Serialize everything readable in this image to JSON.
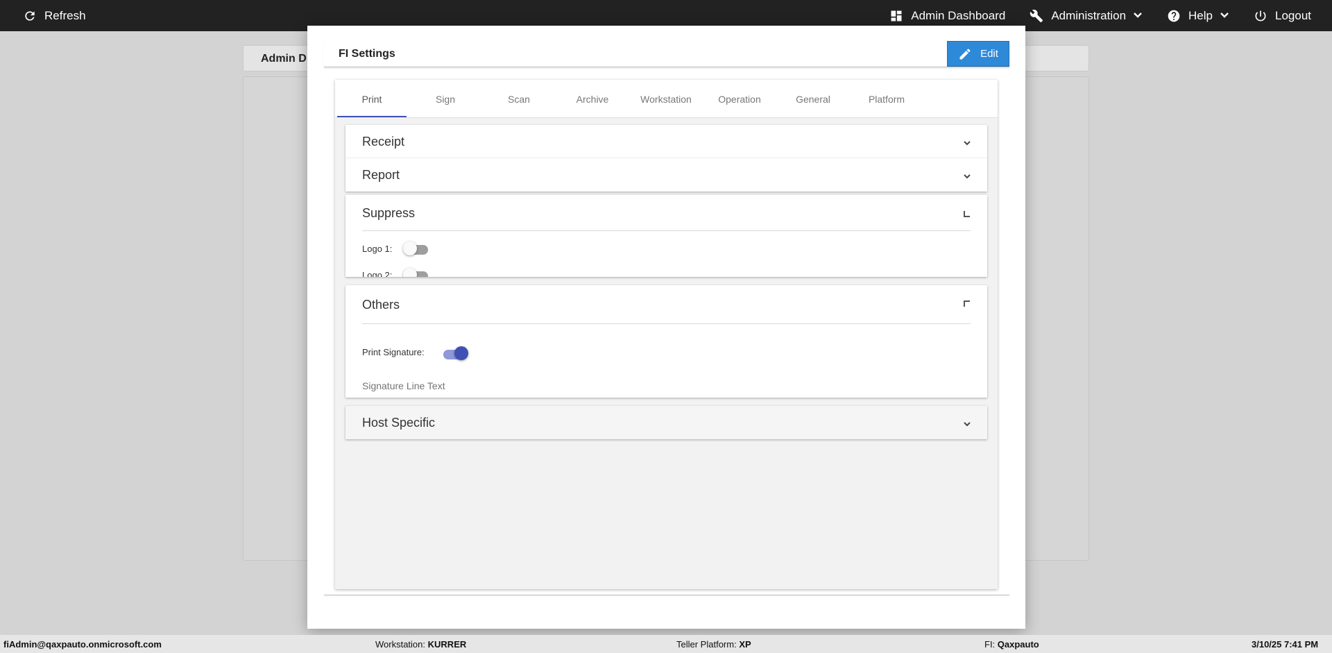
{
  "topbar": {
    "refresh_label": "Refresh",
    "admin_dashboard_label": "Admin Dashboard",
    "administration_label": "Administration",
    "help_label": "Help",
    "logout_label": "Logout"
  },
  "background": {
    "card_title": "Admin D"
  },
  "modal": {
    "title": "FI Settings",
    "edit_label": "Edit",
    "tabs": [
      "Print",
      "Sign",
      "Scan",
      "Archive",
      "Workstation",
      "Operation",
      "General",
      "Platform"
    ],
    "active_tab": "Print",
    "sections": {
      "receipt": {
        "title": "Receipt"
      },
      "report": {
        "title": "Report"
      },
      "suppress": {
        "title": "Suppress",
        "logo1_label": "Logo 1:",
        "logo1_on": false,
        "logo2_label": "Logo 2:",
        "logo2_on": false
      },
      "others": {
        "title": "Others",
        "print_signature_label": "Print Signature:",
        "print_signature_on": true,
        "signature_line_placeholder": "Signature Line Text"
      },
      "host_specific": {
        "title": "Host Specific"
      }
    }
  },
  "statusbar": {
    "user": "fiAdmin@qaxpauto.onmicrosoft.com",
    "workstation_label": "Workstation:",
    "workstation_value": "KURRER",
    "teller_platform_label": "Teller Platform:",
    "teller_platform_value": "XP",
    "fi_label": "FI:",
    "fi_value": "Qaxpauto",
    "datetime": "3/10/25 7:41 PM"
  },
  "colors": {
    "topbar_bg": "#222222",
    "accent": "#3f51b5",
    "edit_button": "#2e89d9"
  }
}
